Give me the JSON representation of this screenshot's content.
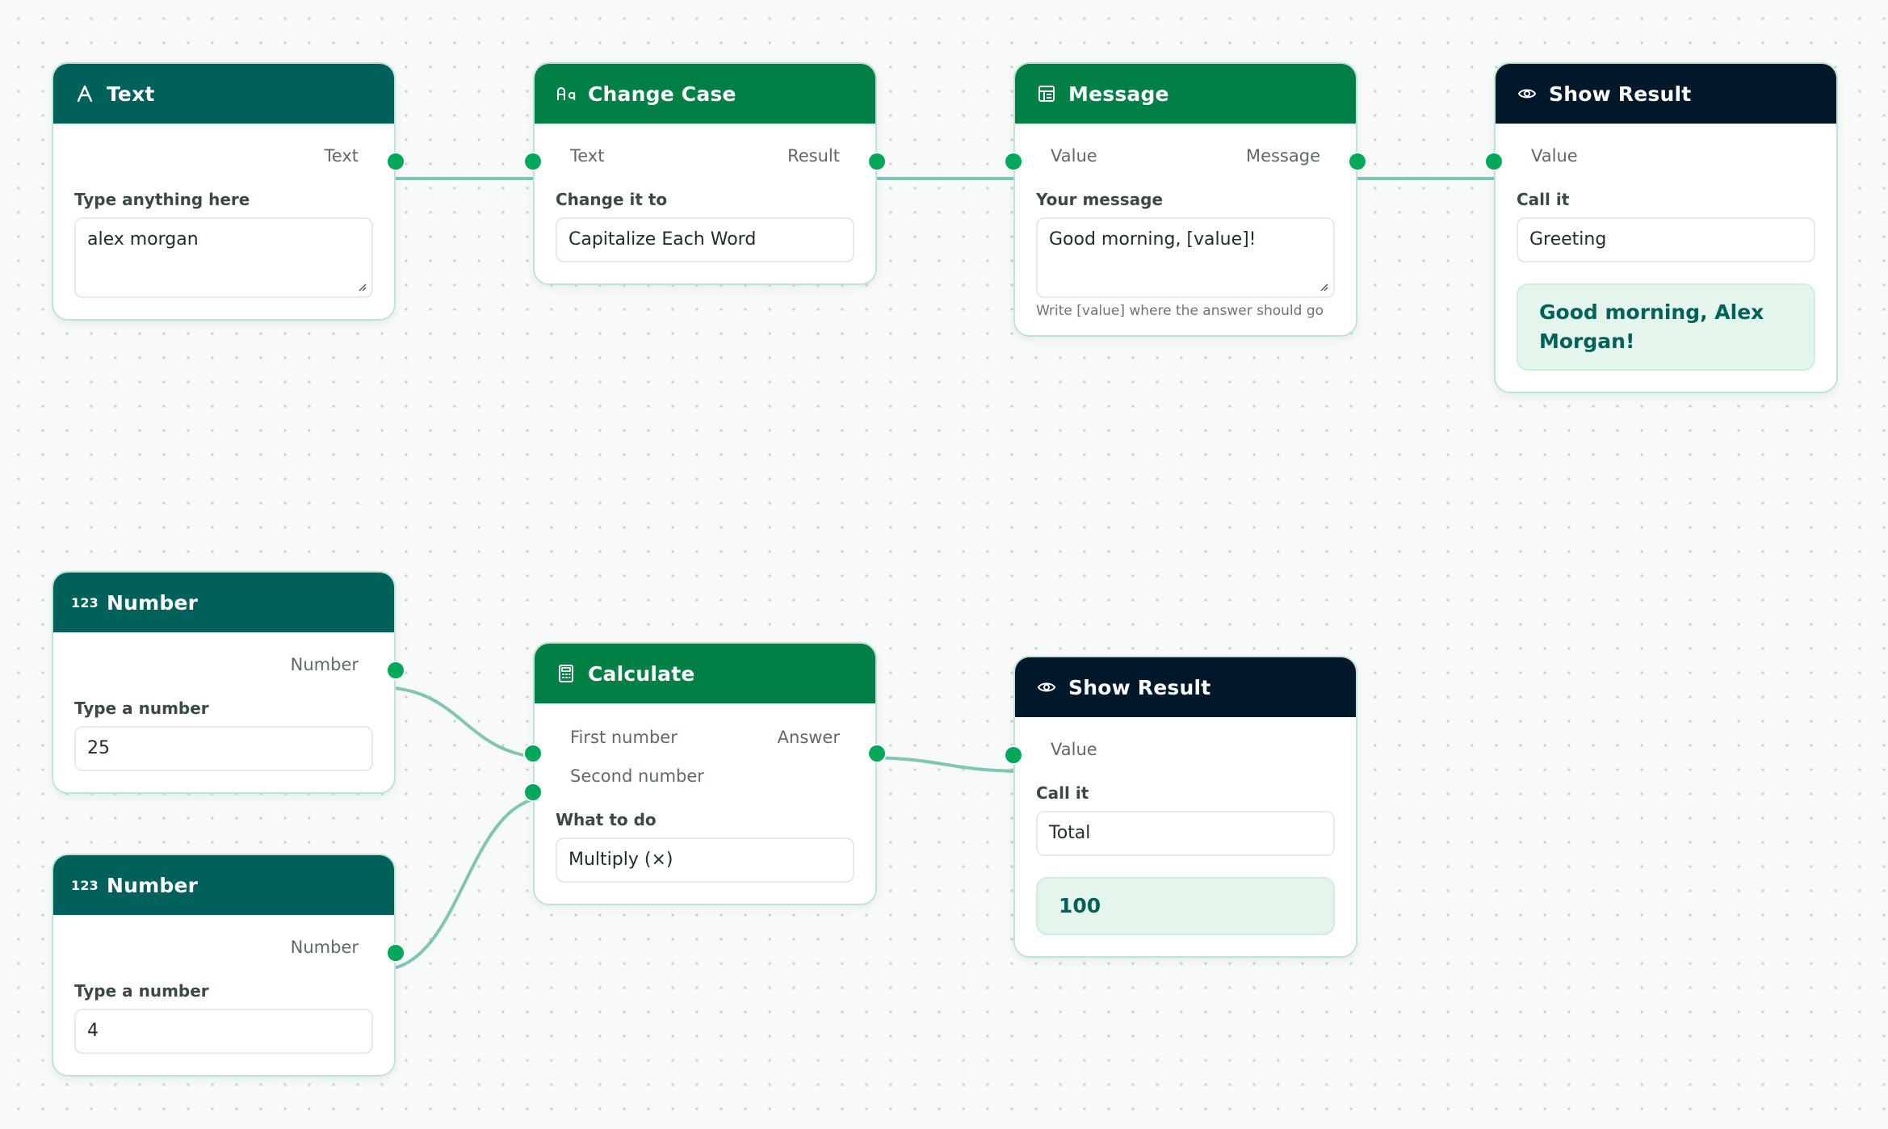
{
  "colors": {
    "header_teal": "#00615a",
    "header_green": "#008045",
    "header_navy": "#01172a",
    "port_dot": "#00a85a",
    "wire": "#7fc6b6",
    "result_bg": "#e4f5ec"
  },
  "nodes": {
    "text": {
      "title": "Text",
      "icon": "text-icon",
      "output_label": "Text",
      "field_label": "Type anything here",
      "value": "alex morgan"
    },
    "change_case": {
      "title": "Change Case",
      "icon": "change-case-icon",
      "input_label": "Text",
      "output_label": "Result",
      "field_label": "Change it to",
      "value": "Capitalize Each Word"
    },
    "message": {
      "title": "Message",
      "icon": "message-icon",
      "input_label": "Value",
      "output_label": "Message",
      "field_label": "Your message",
      "value": "Good morning, [value]!",
      "hint": "Write [value] where the answer should go"
    },
    "show_result_1": {
      "title": "Show Result",
      "icon": "eye-icon",
      "input_label": "Value",
      "field_label": "Call it",
      "value": "Greeting",
      "result": "Good morning, Alex Morgan!"
    },
    "number_1": {
      "title": "Number",
      "icon": "number-icon",
      "icon_text": "123",
      "output_label": "Number",
      "field_label": "Type a number",
      "value": "25"
    },
    "number_2": {
      "title": "Number",
      "icon": "number-icon",
      "icon_text": "123",
      "output_label": "Number",
      "field_label": "Type a number",
      "value": "4"
    },
    "calculate": {
      "title": "Calculate",
      "icon": "calculator-icon",
      "input_label_1": "First number",
      "input_label_2": "Second number",
      "output_label": "Answer",
      "field_label": "What to do",
      "value": "Multiply (×)"
    },
    "show_result_2": {
      "title": "Show Result",
      "icon": "eye-icon",
      "input_label": "Value",
      "field_label": "Call it",
      "value": "Total",
      "result": "100"
    }
  }
}
